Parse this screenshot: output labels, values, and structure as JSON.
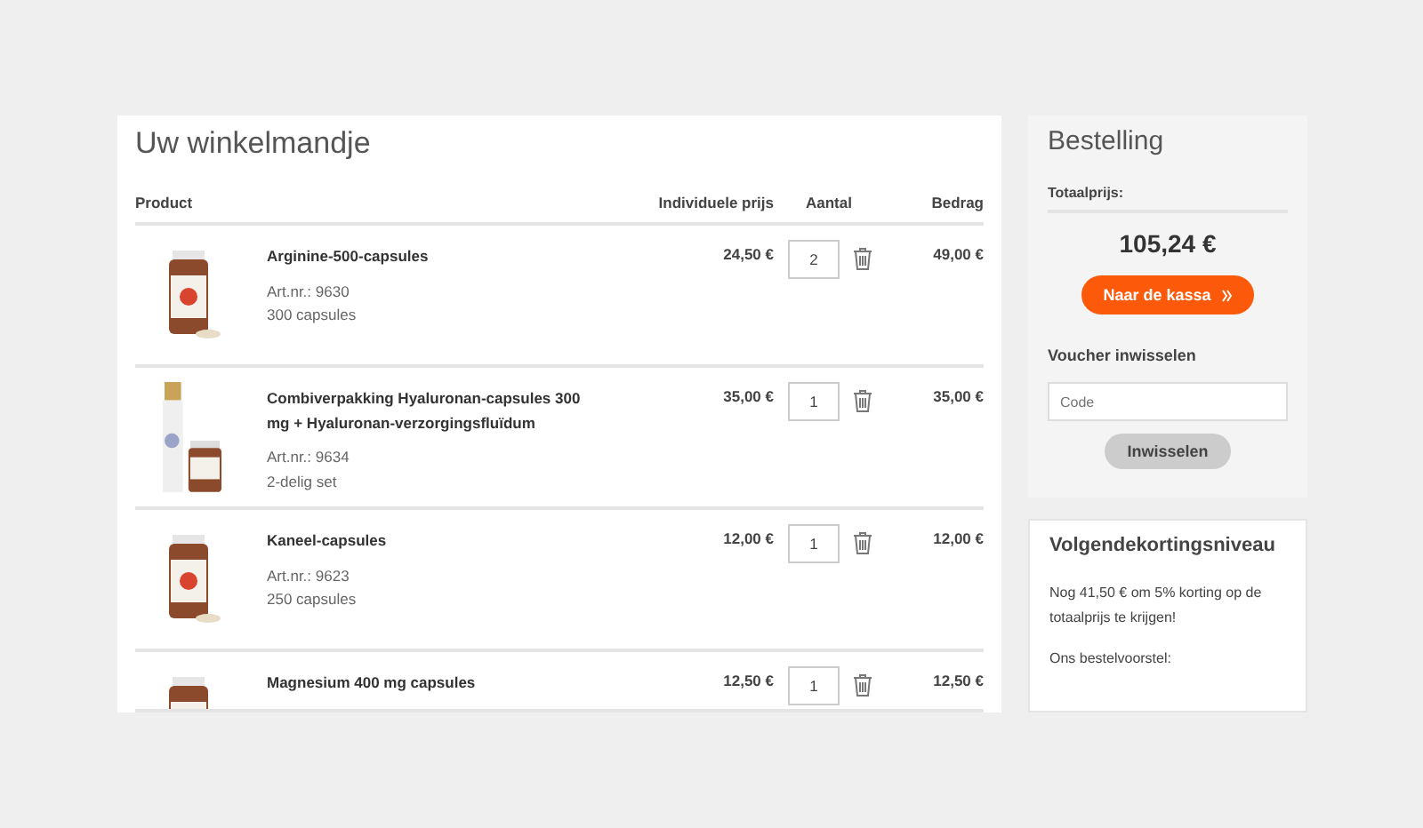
{
  "cart": {
    "title": "Uw winkelmandje",
    "columns": [
      "Product",
      "Individuele prijs",
      "Aantal",
      "Bedrag"
    ],
    "rows": [
      {
        "name": "Arginine-500-capsules",
        "article": "Art.nr.: 9630",
        "package": "300 capsules",
        "unit_price": "24,50 €",
        "quantity": "2",
        "amount": "49,00 €",
        "kind": "bottle"
      },
      {
        "name": "Combiverpakking Hyaluronan-capsules 300 mg + Hyaluronan-verzorgingsfluïdum",
        "article": "Art.nr.: 9634",
        "package": "2-delig set",
        "unit_price": "35,00 €",
        "quantity": "1",
        "amount": "35,00 €",
        "kind": "set"
      },
      {
        "name": "Kaneel-capsules",
        "article": "Art.nr.: 9623",
        "package": "250 capsules",
        "unit_price": "12,00 €",
        "quantity": "1",
        "amount": "12,00 €",
        "kind": "bottle"
      },
      {
        "name": "Magnesium 400 mg capsules",
        "unit_price": "12,50 €",
        "quantity": "1",
        "amount": "12,50 €",
        "kind": "bottle"
      }
    ]
  },
  "order": {
    "title": "Bestelling",
    "total_label": "Totaalprijs:",
    "total": "105,24 €",
    "checkout_button": "Naar de kassa",
    "voucher_title": "Voucher inwisselen",
    "voucher_placeholder": "Code",
    "redeem_button": "Inwisselen"
  },
  "discount": {
    "title": "Volgendekortingsniveau",
    "message": "Nog 41,50 € om 5% korting op de totaalprijs te krijgen!",
    "proposal": "Ons bestelvoorstel:"
  }
}
